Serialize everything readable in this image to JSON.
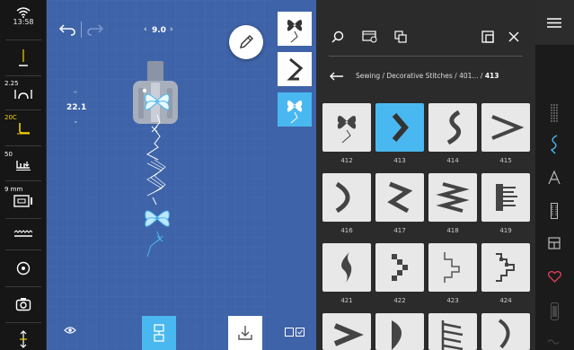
{
  "status": {
    "time": "13:58",
    "stitch_length": "2.25",
    "tension": "20C",
    "speed": "50",
    "presser": "9 mm"
  },
  "canvas": {
    "width_value": "9.0",
    "length_value": "22.1"
  },
  "breadcrumb": {
    "path": "Sewing / Decorative Stitches / 401... / ",
    "current": "413"
  },
  "stitches": [
    {
      "num": "412",
      "selected": false
    },
    {
      "num": "413",
      "selected": true
    },
    {
      "num": "414",
      "selected": false
    },
    {
      "num": "415",
      "selected": false
    },
    {
      "num": "416",
      "selected": false
    },
    {
      "num": "417",
      "selected": false
    },
    {
      "num": "418",
      "selected": false
    },
    {
      "num": "419",
      "selected": false
    },
    {
      "num": "421",
      "selected": false
    },
    {
      "num": "422",
      "selected": false
    },
    {
      "num": "423",
      "selected": false
    },
    {
      "num": "424",
      "selected": false
    }
  ],
  "colors": {
    "canvas_blue": "#3f63a8",
    "accent_cyan": "#4ab8f0",
    "panel_dark": "#2b2b2b",
    "status_yellow": "#f5d200",
    "heart_red": "#e0405a"
  }
}
